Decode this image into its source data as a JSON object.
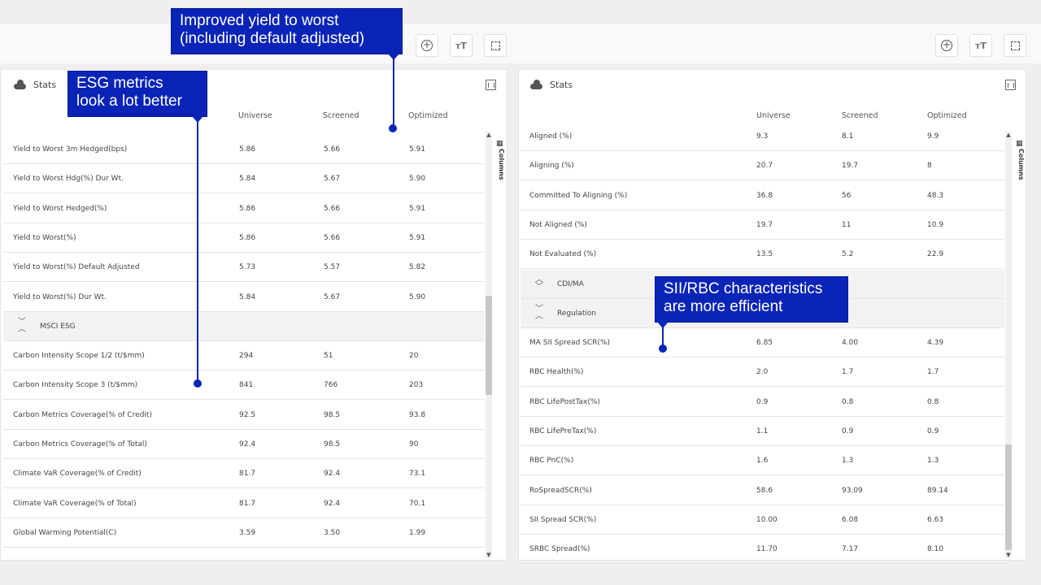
{
  "toolbar": {
    "left_buttons": [
      "plus-circle-icon",
      "text-size-icon",
      "fullscreen-icon"
    ],
    "right_buttons": [
      "plus-circle-icon",
      "text-size-icon",
      "fullscreen-icon"
    ]
  },
  "columns_tab_label": "Columns",
  "left_panel": {
    "title": "Stats",
    "columns": [
      "Universe",
      "Screened",
      "Optimized"
    ],
    "rows": [
      {
        "type": "data",
        "label": "Yield to Worst 3m Hedged(bps)",
        "universe": "5.86",
        "screened": "5.66",
        "optimized": "5.91"
      },
      {
        "type": "data",
        "label": "Yield to Worst Hdg(%) Dur Wt.",
        "universe": "5.84",
        "screened": "5.67",
        "optimized": "5.90"
      },
      {
        "type": "data",
        "label": "Yield to Worst Hedged(%)",
        "universe": "5.86",
        "screened": "5.66",
        "optimized": "5.91"
      },
      {
        "type": "data",
        "label": "Yield to Worst(%)",
        "universe": "5.86",
        "screened": "5.66",
        "optimized": "5.91"
      },
      {
        "type": "data",
        "label": "Yield to Worst(%) Default Adjusted",
        "universe": "5.73",
        "screened": "5.57",
        "optimized": "5.82"
      },
      {
        "type": "data",
        "label": "Yield to Worst(%) Dur Wt.",
        "universe": "5.84",
        "screened": "5.67",
        "optimized": "5.90"
      },
      {
        "type": "group",
        "label": "MSCI ESG"
      },
      {
        "type": "data",
        "label": "Carbon Intensity Scope 1/2 (t/$mm)",
        "universe": "294",
        "screened": "51",
        "optimized": "20"
      },
      {
        "type": "data",
        "label": "Carbon Intensity Scope 3 (t/$mm)",
        "universe": "841",
        "screened": "766",
        "optimized": "203"
      },
      {
        "type": "data",
        "label": "Carbon Metrics Coverage(% of Credit)",
        "universe": "92.5",
        "screened": "98.5",
        "optimized": "93.8"
      },
      {
        "type": "data",
        "label": "Carbon Metrics Coverage(% of Total)",
        "universe": "92.4",
        "screened": "98.5",
        "optimized": "90"
      },
      {
        "type": "data",
        "label": "Climate VaR Coverage(% of Credit)",
        "universe": "81.7",
        "screened": "92.4",
        "optimized": "73.1"
      },
      {
        "type": "data",
        "label": "Climate VaR Coverage(% of Total)",
        "universe": "81.7",
        "screened": "92.4",
        "optimized": "70.1"
      },
      {
        "type": "data",
        "label": "Global Warming Potential(C)",
        "universe": "3.59",
        "screened": "3.50",
        "optimized": "1.99"
      }
    ]
  },
  "right_panel": {
    "title": "Stats",
    "columns": [
      "Universe",
      "Screened",
      "Optimized"
    ],
    "rows": [
      {
        "type": "data",
        "label": "Aligned (%)",
        "universe": "9.3",
        "screened": "8.1",
        "optimized": "9.9"
      },
      {
        "type": "data",
        "label": "Aligning (%)",
        "universe": "20.7",
        "screened": "19.7",
        "optimized": "8"
      },
      {
        "type": "data",
        "label": "Committed To Aligning (%)",
        "universe": "36.8",
        "screened": "56",
        "optimized": "48.3"
      },
      {
        "type": "data",
        "label": "Not Aligned (%)",
        "universe": "19.7",
        "screened": "11",
        "optimized": "10.9"
      },
      {
        "type": "data",
        "label": "Not Evaluated (%)",
        "universe": "13.5",
        "screened": "5.2",
        "optimized": "22.9"
      },
      {
        "type": "group",
        "label": "CDI/MA",
        "state": "collapsed"
      },
      {
        "type": "group",
        "label": "Regulation",
        "state": "expanded"
      },
      {
        "type": "data",
        "label": "MA SII Spread SCR(%)",
        "universe": "6.85",
        "screened": "4.00",
        "optimized": "4.39"
      },
      {
        "type": "data",
        "label": "RBC Health(%)",
        "universe": "2.0",
        "screened": "1.7",
        "optimized": "1.7"
      },
      {
        "type": "data",
        "label": "RBC LifePostTax(%)",
        "universe": "0.9",
        "screened": "0.8",
        "optimized": "0.8"
      },
      {
        "type": "data",
        "label": "RBC LifePreTax(%)",
        "universe": "1.1",
        "screened": "0.9",
        "optimized": "0.9"
      },
      {
        "type": "data",
        "label": "RBC PnC(%)",
        "universe": "1.6",
        "screened": "1.3",
        "optimized": "1.3"
      },
      {
        "type": "data",
        "label": "RoSpreadSCR(%)",
        "universe": "58.6",
        "screened": "93.09",
        "optimized": "89.14"
      },
      {
        "type": "data",
        "label": "SII Spread SCR(%)",
        "universe": "10.00",
        "screened": "6.08",
        "optimized": "6.63"
      },
      {
        "type": "data",
        "label": "SRBC Spread(%)",
        "universe": "11.70",
        "screened": "7.17",
        "optimized": "8.10"
      }
    ]
  },
  "callouts": {
    "yield": "Improved yield to worst\n(including default adjusted)",
    "esg": "ESG metrics\nlook a lot better",
    "sii": "SII/RBC characteristics\nare more efficient"
  },
  "colors": {
    "callout_bg": "#0a24b8",
    "group_row_bg": "#f2f2f2",
    "page_bg": "#efefef"
  }
}
